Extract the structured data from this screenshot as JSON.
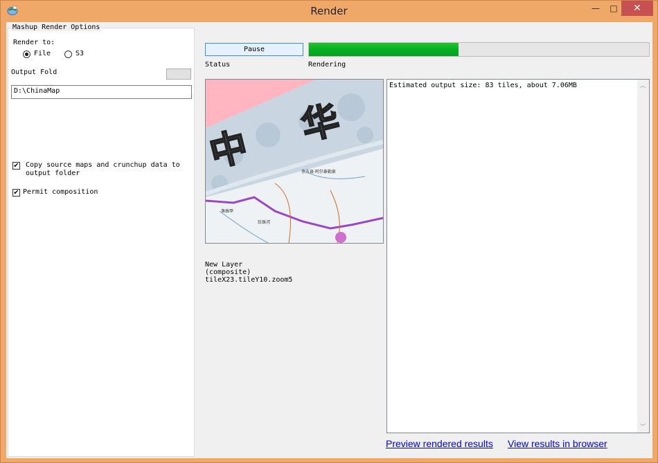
{
  "window": {
    "title": "Render",
    "icon": "app-globe-icon",
    "controls": {
      "minimize": "—",
      "maximize": "□",
      "close": "✕"
    },
    "accent": "#f0a868"
  },
  "options": {
    "group_title": "Mashup Render Options",
    "render_to_label": "Render to:",
    "render_choices": [
      {
        "label": "File",
        "selected": true
      },
      {
        "label": "S3",
        "selected": false
      }
    ],
    "output_folder_label": "Output Fold",
    "browse_label": "",
    "output_folder_value": "D:\\ChinaMap",
    "copy_source_label_line1": "Copy source maps and crunchup data to",
    "copy_source_label_line2": "output folder",
    "copy_source_checked": true,
    "permit_composition_label": "Permit composition",
    "permit_composition_checked": true
  },
  "render": {
    "pause_label": "Pause",
    "status_label": "Status",
    "rendering_label": "Rendering",
    "progress_percent": 44,
    "progress_color": "#06b025",
    "preview": {
      "glyph_1": "中",
      "glyph_2": "华",
      "place_1": "东方县·阿尔泰勒泉",
      "place_2": "渔珠甲",
      "place_3": "珍珠河"
    },
    "tile_info_line1": "New Layer",
    "tile_info_line2": "(composite)",
    "tile_info_line3": "tileX23.tileY10.zoom5",
    "output_text": "Estimated output size: 83 tiles, about 7.06MB",
    "preview_link": "Preview rendered results",
    "browser_link": "View results in browser"
  }
}
